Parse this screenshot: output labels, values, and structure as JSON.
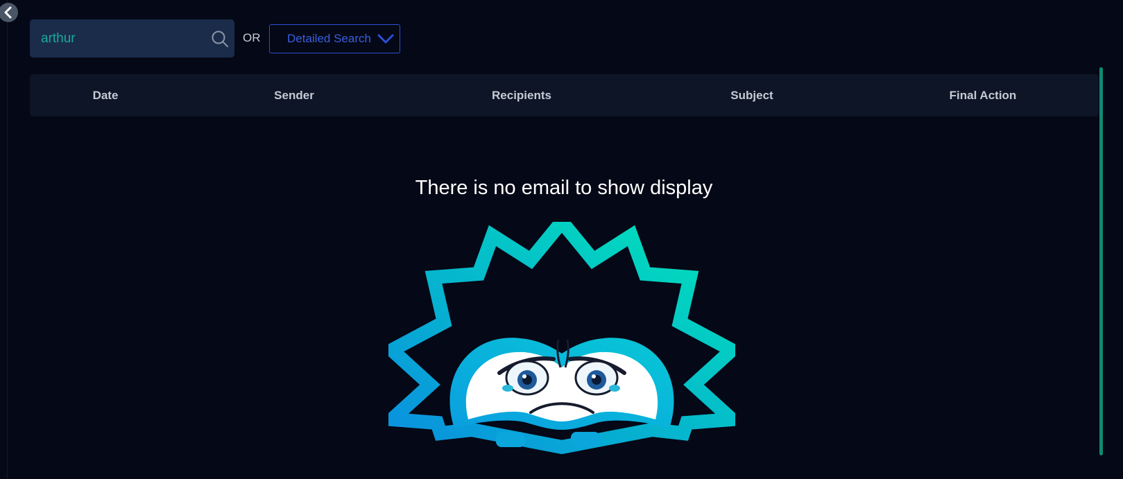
{
  "search": {
    "value": "arthur",
    "or_label": "OR",
    "detailed_search_label": "Detailed Search"
  },
  "table": {
    "columns": [
      "Date",
      "Sender",
      "Recipients",
      "Subject",
      "Final Action"
    ]
  },
  "empty_state": {
    "message": "There is no email to show display",
    "illustration": "sad-face-illustration"
  },
  "icons": {
    "back": "chevron-left-icon",
    "search": "search-icon",
    "dropdown": "chevron-down-icon"
  },
  "colors": {
    "background": "#050816",
    "search_bg": "#1b2c4b",
    "search_text": "#19a9a0",
    "accent_blue": "#2d4fd6",
    "scrollbar": "#0f8a73",
    "gradient_start": "#0a8fe0",
    "gradient_end": "#00e5b8"
  }
}
